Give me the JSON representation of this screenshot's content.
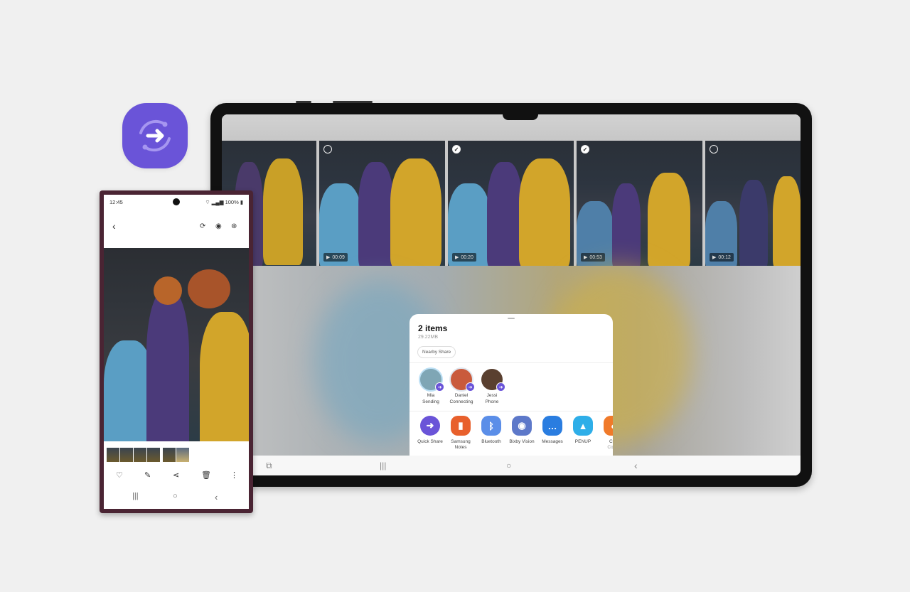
{
  "app_icon": {
    "name": "quick-share-app-icon",
    "color": "#6a54d8"
  },
  "tablet": {
    "thumbnails": [
      {
        "selected": null,
        "duration": ""
      },
      {
        "selected": false,
        "duration": "00:09"
      },
      {
        "selected": true,
        "duration": "00:20"
      },
      {
        "selected": true,
        "duration": "00:53"
      },
      {
        "selected": false,
        "duration": "00:12"
      }
    ],
    "share_sheet": {
      "title": "2 items",
      "size": "29.22MB",
      "nearby_share_label": "Nearby Share",
      "contacts": [
        {
          "name": "Mia",
          "status": "Sending",
          "color": "#7fa6b5"
        },
        {
          "name": "Daniel",
          "status": "Connecting",
          "color": "#c95a3c"
        },
        {
          "name": "Jessi",
          "status": "Phone",
          "color": "#5a4030"
        }
      ],
      "apps": [
        {
          "label": "Quick Share",
          "sub": "",
          "color": "#6a54d8",
          "glyph": "➜"
        },
        {
          "label": "Samsung",
          "sub": "Notes",
          "color": "#e8602c",
          "glyph": "▮"
        },
        {
          "label": "Bluetooth",
          "sub": "",
          "color": "#5b8ee8",
          "glyph": "ᛒ"
        },
        {
          "label": "Bixby Vision",
          "sub": "",
          "color": "#5d78c9",
          "glyph": "◉"
        },
        {
          "label": "Messages",
          "sub": "",
          "color": "#2a7de0",
          "glyph": "…"
        },
        {
          "label": "PENUP",
          "sub": "",
          "color": "#2eaee8",
          "glyph": "▲"
        },
        {
          "label": "Con",
          "sub": "Conta",
          "color": "#f07a2a",
          "glyph": "●"
        }
      ]
    },
    "nav": {
      "recents": "|||",
      "home": "○",
      "back": "‹",
      "screenshot": "⧉"
    }
  },
  "phone": {
    "status": {
      "time": "12:45",
      "battery": "100%"
    },
    "toolbar": {
      "back": "‹",
      "icons": [
        "⟳",
        "◉",
        "⊛"
      ]
    },
    "actions": [
      "♡",
      "✎",
      "⋖",
      "🗑",
      "⋮"
    ],
    "nav": [
      "|||",
      "○",
      "‹"
    ]
  }
}
